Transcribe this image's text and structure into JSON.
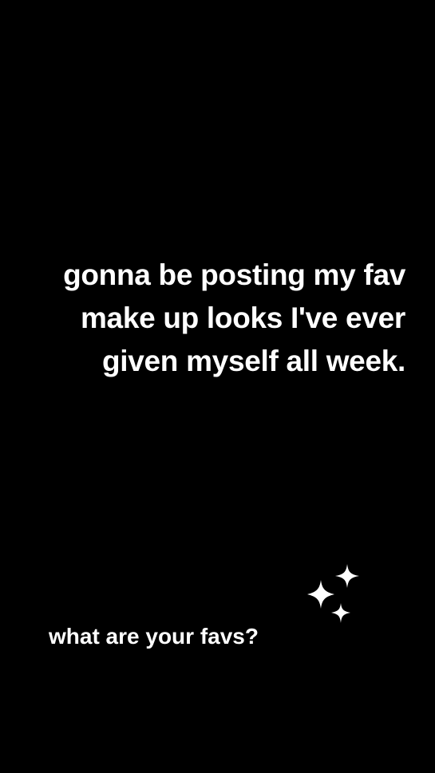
{
  "story": {
    "background_color": "#000000",
    "text_color": "#ffffff",
    "main_text_lines": [
      "gonna be posting my fav",
      "make up looks I've ever",
      "given myself all week."
    ],
    "question_text": "what are your favs?",
    "sticker_icon": "sparkles-icon"
  }
}
